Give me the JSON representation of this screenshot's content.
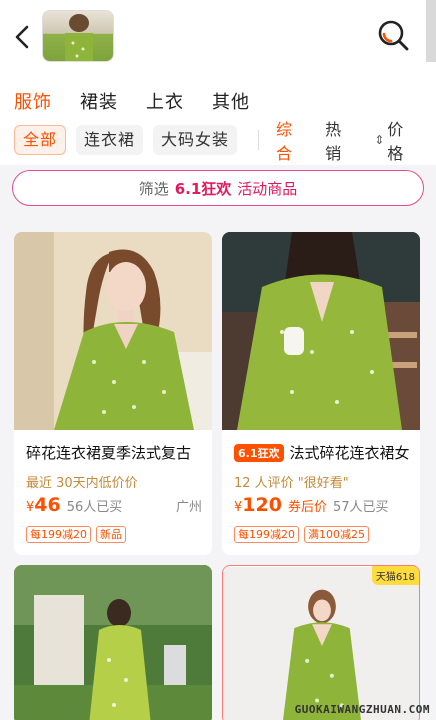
{
  "header": {
    "back_icon": "chevron-left-icon",
    "search_icon": "search-icon"
  },
  "categories": [
    {
      "label": "服饰",
      "active": true
    },
    {
      "label": "裙装",
      "active": false
    },
    {
      "label": "上衣",
      "active": false
    },
    {
      "label": "其他",
      "active": false
    }
  ],
  "subtabs": [
    {
      "label": "全部",
      "active": true
    },
    {
      "label": "连衣裙",
      "active": false
    },
    {
      "label": "大码女装",
      "active": false
    }
  ],
  "sorts": {
    "comprehensive": "综合",
    "hot": "热销",
    "price": "价格"
  },
  "filter": {
    "label": "筛选",
    "highlight": "6.1狂欢",
    "activity": "活动商品"
  },
  "products": [
    {
      "title": "碎花连衣裙夏季法式复古",
      "subtitle": "最近 30天内低价价",
      "currency": "¥",
      "price": "46",
      "sold": "56人已买",
      "location": "广州",
      "badges": [
        "每199减20",
        "新品"
      ]
    },
    {
      "promo_tag": "6.1狂欢",
      "title": "法式碎花连衣裙女",
      "subtitle": "12 人评价 \"很好看\"",
      "currency": "¥",
      "price": "120",
      "after_label": "券后价",
      "sold": "57人已买",
      "badges": [
        "每199减20",
        "满100减25"
      ]
    },
    {},
    {
      "corner_tag": "天猫618"
    }
  ],
  "watermark": "GUOKAIWANGZHUAN.COM",
  "colors": {
    "accent": "#ff5000",
    "promo_pink": "#e5175e",
    "dress_green": "#8fb43a"
  }
}
